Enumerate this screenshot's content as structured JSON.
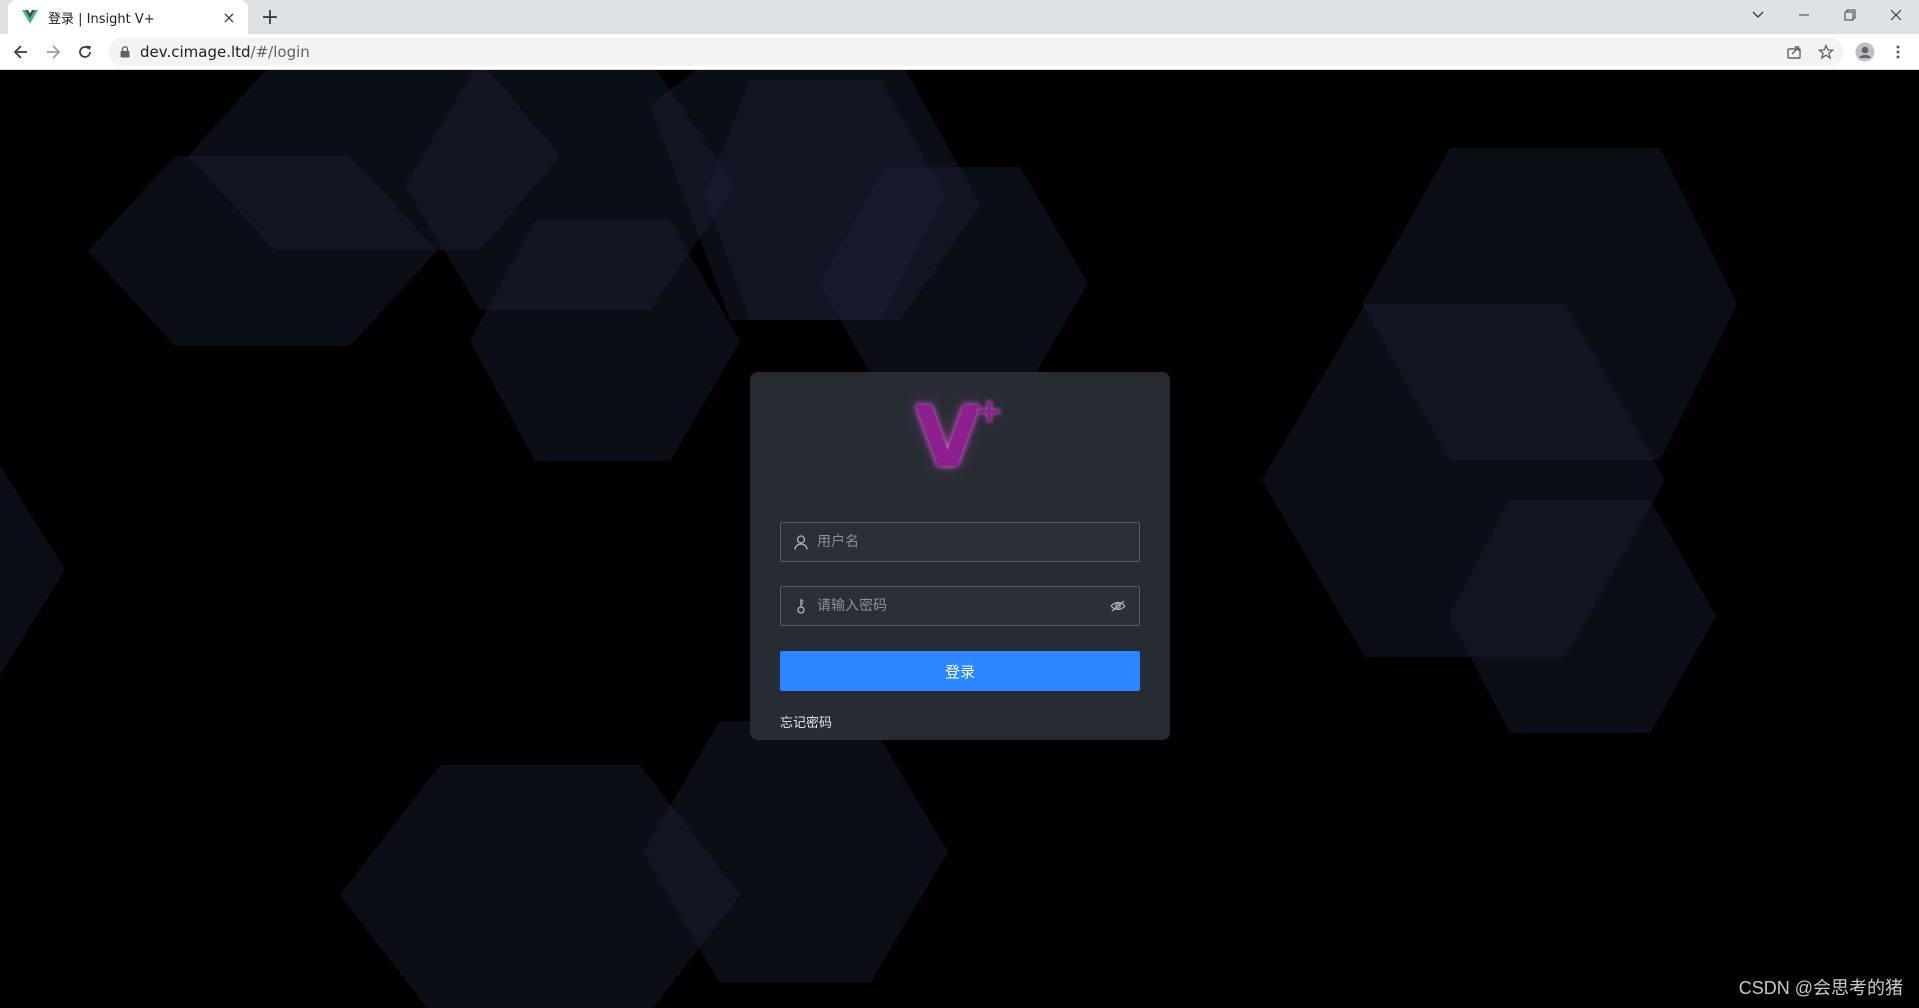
{
  "browser": {
    "tab_title": "登录 | Insight V+",
    "tab_close": "×",
    "new_tab": "+",
    "url_host": "dev.cimage.ltd",
    "url_path": "/#/login"
  },
  "login": {
    "logo_letter": "V",
    "logo_superscript": "+",
    "username_placeholder": "用户名",
    "password_placeholder": "请输入密码",
    "login_button": "登录",
    "forgot_password": "忘记密码"
  },
  "watermark": "CSDN @会思考的猪",
  "colors": {
    "page_background": "#000000",
    "card_background": "#272c34",
    "primary_button": "#2b86ff",
    "logo": "#8e1f8e",
    "hexagon": "#1b1f33"
  },
  "icons": {
    "favicon": "vue-logo-icon",
    "back": "arrow-left-icon",
    "forward": "arrow-right-icon",
    "reload": "reload-icon",
    "lock": "lock-icon",
    "share": "share-icon",
    "bookmark": "star-icon",
    "profile": "profile-icon",
    "menu": "kebab-menu-icon",
    "username": "user-icon",
    "password": "key-icon",
    "toggle_password": "eye-off-icon"
  }
}
